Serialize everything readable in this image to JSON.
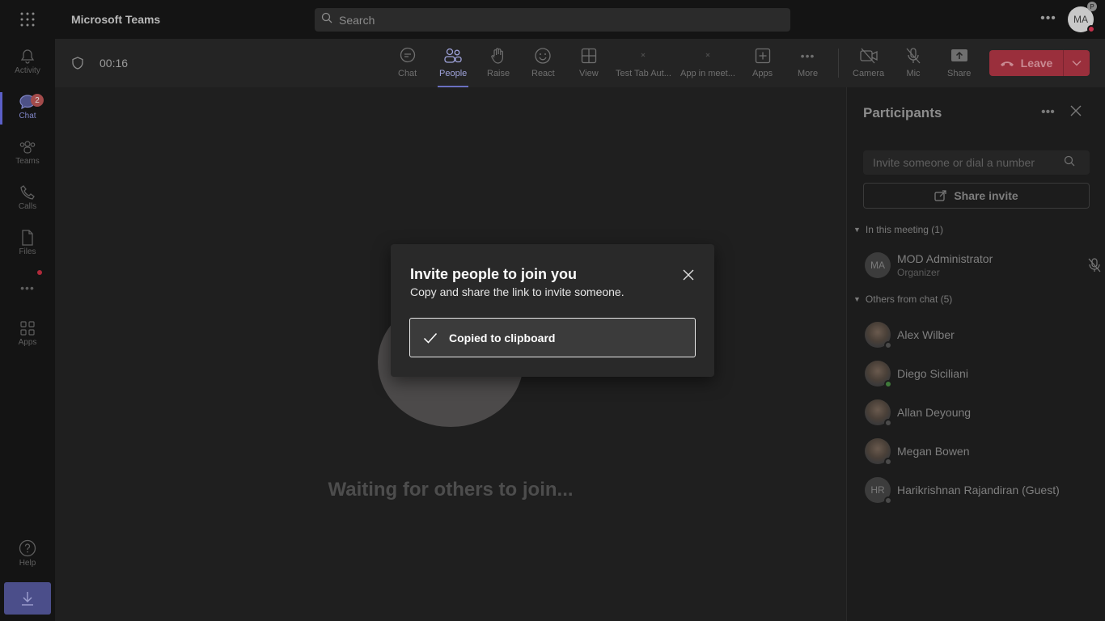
{
  "titlebar": {
    "app_name": "Microsoft Teams",
    "search_placeholder": "Search",
    "avatar_initials": "MA",
    "avatar_badge": "P"
  },
  "rail": {
    "items": [
      {
        "label": "Activity",
        "icon": "bell-icon"
      },
      {
        "label": "Chat",
        "icon": "chat-icon",
        "badge": "2",
        "active": true
      },
      {
        "label": "Teams",
        "icon": "teams-icon"
      },
      {
        "label": "Calls",
        "icon": "phone-icon"
      },
      {
        "label": "Files",
        "icon": "file-icon"
      },
      {
        "label": "",
        "icon": "more-icon"
      },
      {
        "label": "Apps",
        "icon": "apps-icon"
      },
      {
        "label": "Help",
        "icon": "help-icon"
      }
    ]
  },
  "meeting": {
    "timer": "00:16",
    "controls": [
      {
        "label": "Chat",
        "icon": "chat-bubble-icon"
      },
      {
        "label": "People",
        "icon": "people-icon",
        "active": true
      },
      {
        "label": "Raise",
        "icon": "hand-icon"
      },
      {
        "label": "React",
        "icon": "smiley-icon"
      },
      {
        "label": "View",
        "icon": "grid-icon"
      },
      {
        "label": "Test Tab Aut...",
        "icon": "app-icon"
      },
      {
        "label": "App in meet...",
        "icon": "app-icon"
      },
      {
        "label": "Apps",
        "icon": "plus-box-icon"
      },
      {
        "label": "More",
        "icon": "ellipsis-icon"
      },
      {
        "label": "Camera",
        "icon": "camera-off-icon"
      },
      {
        "label": "Mic",
        "icon": "mic-off-icon"
      },
      {
        "label": "Share",
        "icon": "share-icon"
      }
    ],
    "leave_label": "Leave"
  },
  "stage": {
    "waiting_text": "Waiting for others to join..."
  },
  "participants": {
    "title": "Participants",
    "invite_placeholder": "Invite someone or dial a number",
    "share_invite_label": "Share invite",
    "in_meeting_header": "In this meeting (1)",
    "in_meeting": [
      {
        "name": "MOD Administrator",
        "role": "Organizer",
        "initials": "MA"
      }
    ],
    "others_header": "Others from chat (5)",
    "others": [
      {
        "name": "Alex Wilber",
        "initials": "",
        "status": "offline"
      },
      {
        "name": "Diego Siciliani",
        "initials": "",
        "status": "available"
      },
      {
        "name": "Allan Deyoung",
        "initials": "",
        "status": "offline"
      },
      {
        "name": "Megan Bowen",
        "initials": "",
        "status": "offline"
      },
      {
        "name": "Harikrishnan Rajandiran (Guest)",
        "initials": "HR",
        "status": "offline"
      }
    ]
  },
  "dialog": {
    "title": "Invite people to join you",
    "subtitle": "Copy and share the link to invite someone.",
    "copied_label": "Copied to clipboard"
  }
}
